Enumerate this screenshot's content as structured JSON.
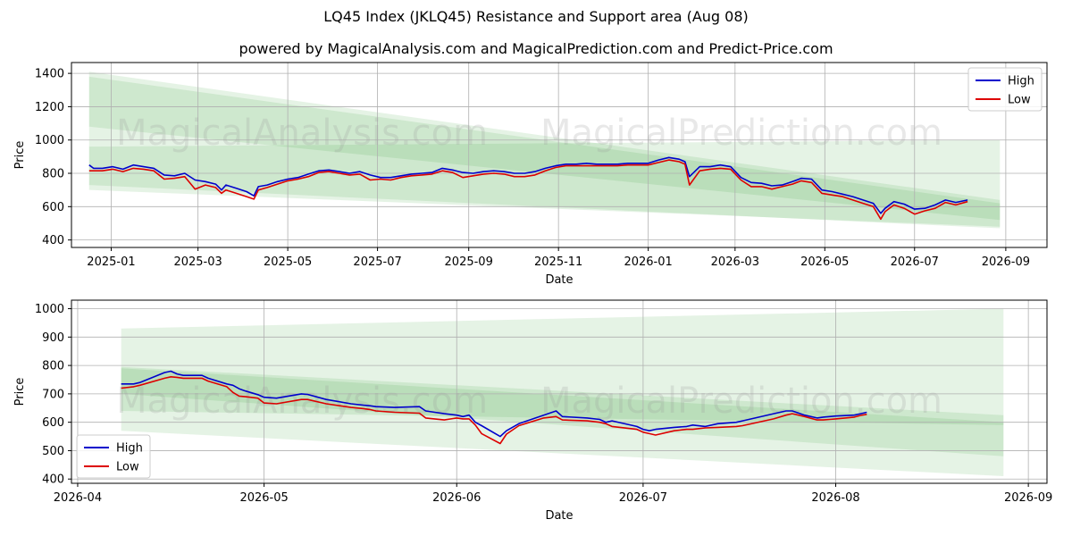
{
  "title": "LQ45 Index (JKLQ45) Resistance and Support area (Aug 08)",
  "subtitle": "powered by MagicalAnalysis.com and MagicalPrediction.com and Predict-Price.com",
  "watermark": [
    "MagicalAnalysis.com",
    "MagicalPrediction.com"
  ],
  "colors": {
    "high": "#0000cc",
    "low": "#dd0000",
    "band": "#2ca02c",
    "grid": "#b0b0b0"
  },
  "chart_data": [
    {
      "type": "line",
      "xlabel": "Date",
      "ylabel": "Price",
      "x_ticks": [
        "2025-01",
        "2025-03",
        "2025-05",
        "2025-07",
        "2025-09",
        "2025-11",
        "2026-01",
        "2026-03",
        "2026-05",
        "2026-07",
        "2026-09"
      ],
      "y_ticks": [
        400,
        600,
        800,
        1000,
        1200,
        1400
      ],
      "xlim": [
        "2024-12-05",
        "2026-09-29"
      ],
      "ylim": [
        355,
        1465
      ],
      "grid": true,
      "legend": {
        "position": "top-right",
        "entries": [
          "High",
          "Low"
        ]
      },
      "bands": [
        {
          "start": "2024-12-17",
          "end": "2026-08-28",
          "upper": [
            1410,
            640
          ],
          "lower": [
            1080,
            520
          ]
        },
        {
          "start": "2024-12-17",
          "end": "2026-08-28",
          "upper": [
            1380,
            620
          ],
          "lower": [
            700,
            480
          ]
        },
        {
          "start": "2024-12-17",
          "end": "2026-08-28",
          "upper": [
            960,
            1000
          ],
          "lower": [
            730,
            470
          ]
        }
      ],
      "series": [
        {
          "name": "High",
          "x": [
            "2024-12-17",
            "2024-12-20",
            "2024-12-26",
            "2025-01-02",
            "2025-01-09",
            "2025-01-16",
            "2025-01-23",
            "2025-01-30",
            "2025-02-06",
            "2025-02-13",
            "2025-02-20",
            "2025-02-27",
            "2025-03-06",
            "2025-03-13",
            "2025-03-17",
            "2025-03-20",
            "2025-03-27",
            "2025-04-03",
            "2025-04-08",
            "2025-04-11",
            "2025-04-17",
            "2025-04-24",
            "2025-05-01",
            "2025-05-08",
            "2025-05-15",
            "2025-05-22",
            "2025-05-29",
            "2025-06-05",
            "2025-06-12",
            "2025-06-19",
            "2025-06-26",
            "2025-07-03",
            "2025-07-10",
            "2025-07-17",
            "2025-07-24",
            "2025-07-31",
            "2025-08-07",
            "2025-08-14",
            "2025-08-21",
            "2025-08-28",
            "2025-09-04",
            "2025-09-11",
            "2025-09-18",
            "2025-09-25",
            "2025-10-02",
            "2025-10-09",
            "2025-10-16",
            "2025-10-23",
            "2025-10-30",
            "2025-11-06",
            "2025-11-13",
            "2025-11-20",
            "2025-11-27",
            "2025-12-04",
            "2025-12-11",
            "2025-12-18",
            "2025-12-25",
            "2026-01-01",
            "2026-01-08",
            "2026-01-15",
            "2026-01-22",
            "2026-01-26",
            "2026-01-29",
            "2026-02-05",
            "2026-02-12",
            "2026-02-19",
            "2026-02-26",
            "2026-03-05",
            "2026-03-12",
            "2026-03-19",
            "2026-03-26",
            "2026-04-02",
            "2026-04-09",
            "2026-04-15",
            "2026-04-22",
            "2026-04-29",
            "2026-05-06",
            "2026-05-13",
            "2026-05-20",
            "2026-05-27",
            "2026-06-03",
            "2026-06-08",
            "2026-06-11",
            "2026-06-17",
            "2026-06-24",
            "2026-07-01",
            "2026-07-08",
            "2026-07-15",
            "2026-07-22",
            "2026-07-29",
            "2026-08-06"
          ],
          "values": [
            850,
            830,
            830,
            840,
            825,
            850,
            840,
            830,
            790,
            785,
            800,
            760,
            750,
            735,
            700,
            730,
            710,
            690,
            665,
            720,
            730,
            750,
            765,
            775,
            795,
            815,
            820,
            810,
            800,
            810,
            790,
            775,
            775,
            785,
            795,
            800,
            805,
            830,
            820,
            805,
            800,
            810,
            815,
            810,
            800,
            800,
            810,
            830,
            845,
            855,
            855,
            860,
            855,
            855,
            855,
            860,
            860,
            860,
            880,
            895,
            885,
            870,
            780,
            840,
            840,
            850,
            840,
            775,
            745,
            740,
            725,
            730,
            750,
            770,
            765,
            700,
            690,
            675,
            660,
            640,
            620,
            560,
            590,
            630,
            615,
            585,
            590,
            610,
            640,
            625,
            640
          ]
        },
        {
          "name": "Low",
          "x": [
            "2024-12-17",
            "2024-12-20",
            "2024-12-26",
            "2025-01-02",
            "2025-01-09",
            "2025-01-16",
            "2025-01-23",
            "2025-01-30",
            "2025-02-06",
            "2025-02-13",
            "2025-02-20",
            "2025-02-27",
            "2025-03-06",
            "2025-03-13",
            "2025-03-17",
            "2025-03-20",
            "2025-03-27",
            "2025-04-03",
            "2025-04-08",
            "2025-04-11",
            "2025-04-17",
            "2025-04-24",
            "2025-05-01",
            "2025-05-08",
            "2025-05-15",
            "2025-05-22",
            "2025-05-29",
            "2025-06-05",
            "2025-06-12",
            "2025-06-19",
            "2025-06-26",
            "2025-07-03",
            "2025-07-10",
            "2025-07-17",
            "2025-07-24",
            "2025-07-31",
            "2025-08-07",
            "2025-08-14",
            "2025-08-21",
            "2025-08-28",
            "2025-09-04",
            "2025-09-11",
            "2025-09-18",
            "2025-09-25",
            "2025-10-02",
            "2025-10-09",
            "2025-10-16",
            "2025-10-23",
            "2025-10-30",
            "2025-11-06",
            "2025-11-13",
            "2025-11-20",
            "2025-11-27",
            "2025-12-04",
            "2025-12-11",
            "2025-12-18",
            "2025-12-25",
            "2026-01-01",
            "2026-01-08",
            "2026-01-15",
            "2026-01-22",
            "2026-01-26",
            "2026-01-29",
            "2026-02-05",
            "2026-02-12",
            "2026-02-19",
            "2026-02-26",
            "2026-03-05",
            "2026-03-12",
            "2026-03-19",
            "2026-03-26",
            "2026-04-02",
            "2026-04-09",
            "2026-04-15",
            "2026-04-22",
            "2026-04-29",
            "2026-05-06",
            "2026-05-13",
            "2026-05-20",
            "2026-05-27",
            "2026-06-03",
            "2026-06-08",
            "2026-06-11",
            "2026-06-17",
            "2026-06-24",
            "2026-07-01",
            "2026-07-08",
            "2026-07-15",
            "2026-07-22",
            "2026-07-29",
            "2026-08-06"
          ],
          "values": [
            815,
            815,
            815,
            825,
            810,
            830,
            825,
            815,
            765,
            770,
            780,
            705,
            730,
            715,
            680,
            700,
            680,
            660,
            645,
            700,
            715,
            735,
            755,
            765,
            780,
            805,
            810,
            800,
            790,
            795,
            760,
            765,
            760,
            775,
            785,
            790,
            795,
            815,
            805,
            775,
            785,
            795,
            800,
            795,
            780,
            780,
            790,
            815,
            835,
            845,
            845,
            845,
            845,
            845,
            845,
            850,
            850,
            850,
            865,
            880,
            870,
            855,
            730,
            815,
            825,
            830,
            825,
            760,
            720,
            720,
            705,
            720,
            735,
            755,
            745,
            680,
            670,
            660,
            640,
            620,
            600,
            525,
            570,
            610,
            590,
            555,
            575,
            590,
            625,
            610,
            630
          ]
        }
      ]
    },
    {
      "type": "line",
      "xlabel": "Date",
      "ylabel": "Price",
      "x_ticks": [
        "2026-04",
        "2026-05",
        "2026-06",
        "2026-07",
        "2026-08",
        "2026-09"
      ],
      "y_ticks": [
        400,
        500,
        600,
        700,
        800,
        900,
        1000
      ],
      "xlim": [
        "2026-03-31",
        "2026-09-04"
      ],
      "ylim": [
        385,
        1030
      ],
      "grid": true,
      "legend": {
        "position": "bottom-left",
        "entries": [
          "High",
          "Low"
        ]
      },
      "bands": [
        {
          "start": "2026-04-08",
          "end": "2026-08-28",
          "upper": [
            930,
            1000
          ],
          "lower": [
            640,
            590
          ]
        },
        {
          "start": "2026-04-08",
          "end": "2026-08-28",
          "upper": [
            795,
            625
          ],
          "lower": [
            700,
            480
          ]
        },
        {
          "start": "2026-04-08",
          "end": "2026-08-28",
          "upper": [
            790,
            600
          ],
          "lower": [
            570,
            410
          ]
        }
      ],
      "series": [
        {
          "name": "High",
          "x": [
            "2026-04-08",
            "2026-04-10",
            "2026-04-11",
            "2026-04-15",
            "2026-04-16",
            "2026-04-17",
            "2026-04-18",
            "2026-04-21",
            "2026-04-22",
            "2026-04-25",
            "2026-04-26",
            "2026-04-27",
            "2026-04-28",
            "2026-04-30",
            "2026-05-01",
            "2026-05-03",
            "2026-05-07",
            "2026-05-08",
            "2026-05-11",
            "2026-05-15",
            "2026-05-17",
            "2026-05-18",
            "2026-05-19",
            "2026-05-22",
            "2026-05-26",
            "2026-05-27",
            "2026-05-30",
            "2026-06-01",
            "2026-06-02",
            "2026-06-03",
            "2026-06-04",
            "2026-06-05",
            "2026-06-08",
            "2026-06-09",
            "2026-06-11",
            "2026-06-15",
            "2026-06-17",
            "2026-06-18",
            "2026-06-22",
            "2026-06-24",
            "2026-06-25",
            "2026-06-26",
            "2026-06-30",
            "2026-07-01",
            "2026-07-02",
            "2026-07-03",
            "2026-07-06",
            "2026-07-08",
            "2026-07-09",
            "2026-07-11",
            "2026-07-13",
            "2026-07-16",
            "2026-07-17",
            "2026-07-22",
            "2026-07-24",
            "2026-07-25",
            "2026-07-27",
            "2026-07-29",
            "2026-07-30",
            "2026-07-31",
            "2026-08-01",
            "2026-08-04",
            "2026-08-05",
            "2026-08-06"
          ],
          "values": [
            735,
            735,
            740,
            775,
            780,
            770,
            765,
            765,
            755,
            735,
            730,
            718,
            710,
            697,
            688,
            685,
            700,
            698,
            680,
            665,
            660,
            658,
            655,
            652,
            655,
            640,
            630,
            625,
            620,
            625,
            600,
            588,
            550,
            570,
            595,
            625,
            640,
            620,
            615,
            610,
            600,
            605,
            585,
            575,
            570,
            575,
            582,
            585,
            590,
            585,
            595,
            600,
            605,
            630,
            640,
            640,
            625,
            615,
            618,
            620,
            622,
            625,
            630,
            635
          ]
        },
        {
          "name": "Low",
          "x": [
            "2026-04-08",
            "2026-04-10",
            "2026-04-11",
            "2026-04-15",
            "2026-04-16",
            "2026-04-17",
            "2026-04-18",
            "2026-04-21",
            "2026-04-22",
            "2026-04-25",
            "2026-04-26",
            "2026-04-27",
            "2026-04-28",
            "2026-04-30",
            "2026-05-01",
            "2026-05-03",
            "2026-05-07",
            "2026-05-08",
            "2026-05-11",
            "2026-05-15",
            "2026-05-17",
            "2026-05-18",
            "2026-05-19",
            "2026-05-22",
            "2026-05-26",
            "2026-05-27",
            "2026-05-30",
            "2026-06-01",
            "2026-06-02",
            "2026-06-03",
            "2026-06-04",
            "2026-06-05",
            "2026-06-08",
            "2026-06-09",
            "2026-06-11",
            "2026-06-15",
            "2026-06-17",
            "2026-06-18",
            "2026-06-22",
            "2026-06-24",
            "2026-06-25",
            "2026-06-26",
            "2026-06-30",
            "2026-07-01",
            "2026-07-02",
            "2026-07-03",
            "2026-07-06",
            "2026-07-08",
            "2026-07-09",
            "2026-07-11",
            "2026-07-13",
            "2026-07-16",
            "2026-07-17",
            "2026-07-22",
            "2026-07-24",
            "2026-07-25",
            "2026-07-27",
            "2026-07-29",
            "2026-07-30",
            "2026-07-31",
            "2026-08-01",
            "2026-08-04",
            "2026-08-05",
            "2026-08-06"
          ],
          "values": [
            720,
            725,
            730,
            755,
            760,
            758,
            755,
            755,
            745,
            725,
            705,
            692,
            690,
            685,
            668,
            665,
            680,
            680,
            665,
            652,
            648,
            645,
            640,
            635,
            632,
            615,
            608,
            615,
            612,
            612,
            590,
            560,
            525,
            558,
            588,
            615,
            620,
            608,
            605,
            600,
            595,
            585,
            575,
            565,
            560,
            555,
            570,
            575,
            575,
            580,
            582,
            585,
            588,
            612,
            625,
            630,
            620,
            608,
            608,
            610,
            612,
            618,
            624,
            628
          ]
        }
      ]
    }
  ]
}
